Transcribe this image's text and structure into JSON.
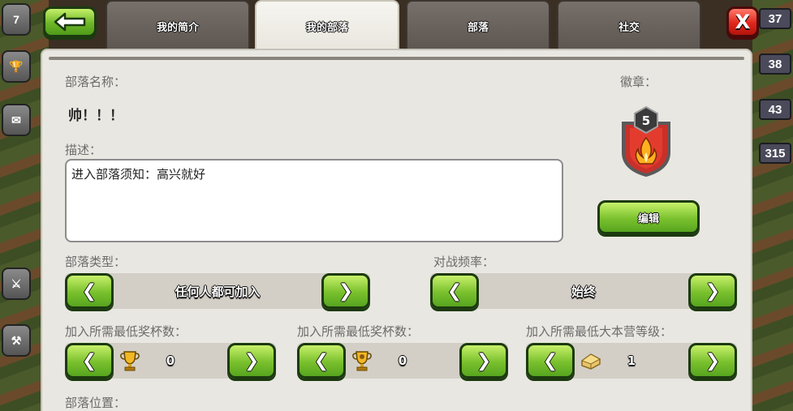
{
  "tabs": [
    {
      "label": "我的简介"
    },
    {
      "label": "我的部落"
    },
    {
      "label": "部落"
    },
    {
      "label": "社交"
    }
  ],
  "buttons": {
    "back_icon": "arrow-left-icon",
    "close_label": "X",
    "edit_label": "编辑"
  },
  "clan": {
    "name_label": "部落名称：",
    "name": "帅！！！",
    "badge_label": "徽章：",
    "badge_level": "5",
    "description_label": "描述：",
    "description": "进入部落须知：高兴就好",
    "type_label": "部落类型：",
    "type_value": "任何人都可加入",
    "war_frequency_label": "对战频率：",
    "war_frequency_value": "始终",
    "min_trophies_label": "加入所需最低奖杯数：",
    "min_trophies_value": "0",
    "min_builder_trophies_label": "加入所需最低奖杯数：",
    "min_builder_trophies_value": "0",
    "min_townhall_label": "加入所需最低大本营等级：",
    "min_townhall_value": "1",
    "location_label": "部落位置："
  },
  "arrows": {
    "left": "❮",
    "right": "❯"
  },
  "side": {
    "left_tiles": [
      "7",
      "",
      "",
      "",
      "",
      ""
    ],
    "right_badges": [
      "37",
      "38",
      "43",
      "315"
    ]
  },
  "colors": {
    "accent_green": "#6fb728",
    "close_red": "#e0261c",
    "panel_bg": "#e9e7e2"
  }
}
